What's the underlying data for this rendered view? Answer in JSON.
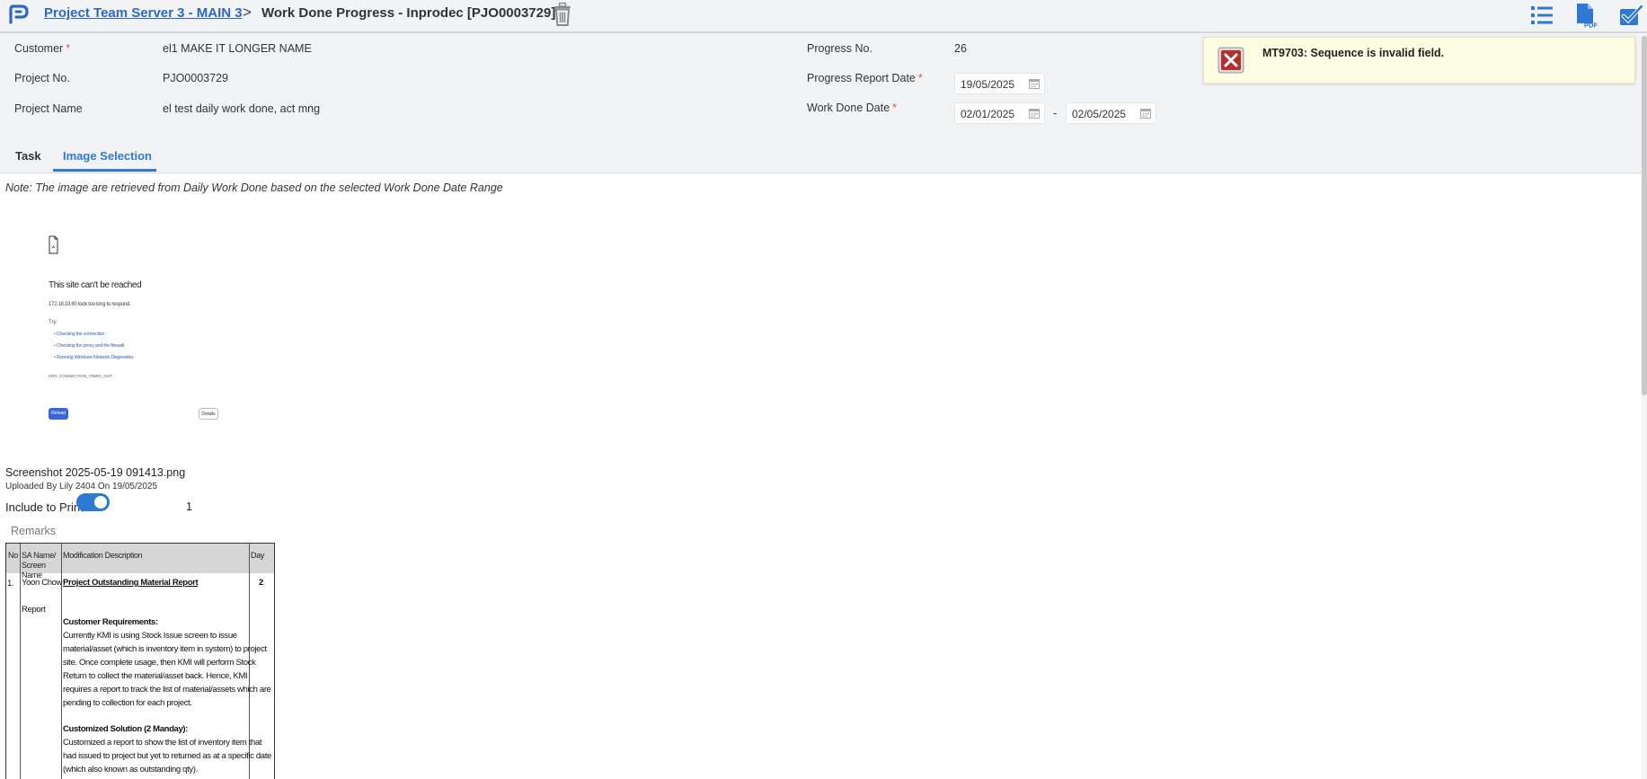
{
  "topbar": {
    "breadcrumb_link": "Project Team Server 3 - MAIN 3",
    "breadcrumb_sep": ">",
    "page_title": "Work Done Progress - Inprodec [PJO0003729]",
    "icons": [
      "logo-icon",
      "trash-icon",
      "list-icon",
      "pdf-icon",
      "checkbox-icon"
    ]
  },
  "header": {
    "customer_label": "Customer",
    "customer_value": "el1 MAKE IT LONGER NAME",
    "project_no_label": "Project No.",
    "project_no_value": "PJO0003729",
    "project_name_label": "Project Name",
    "project_name_value": "el test daily work done, act mng",
    "progress_no_label": "Progress No.",
    "progress_no_value": "26",
    "progress_report_date_label": "Progress Report Date",
    "progress_report_date_value": "19/05/2025",
    "work_done_date_label": "Work Done Date",
    "work_done_from": "02/01/2025",
    "work_done_separator": "-",
    "work_done_to": "02/05/2025",
    "required_mark": "*"
  },
  "tabs": [
    {
      "label": "Task",
      "active": false
    },
    {
      "label": "Image Selection",
      "active": true
    }
  ],
  "toast": {
    "message": "MT9703: Sequence is invalid field.",
    "type": "error"
  },
  "image_selection": {
    "note": "Note: The image are retrieved from Daily Work Done based on the selected Work Done Date Range",
    "thumbnail": {
      "heading": "This site can't be reached",
      "subtext": "172.18.19.60 took too long to respond.",
      "try_label": "Try:",
      "items": [
        "Checking the connection",
        "Checking the proxy and the firewall",
        "Running Windows Network Diagnostics"
      ],
      "error_code": "ERR_CONNECTION_TIMED_OUT",
      "reload_label": "Reload",
      "details_label": "Details"
    },
    "file_name": "Screenshot 2025-05-19 091413.png",
    "uploaded_by": "Uploaded By Lily 2404 On 19/05/2025",
    "include_to_print_label": "Include to Print",
    "include_to_print": true,
    "sequence": "1",
    "remarks_label": "Remarks"
  },
  "remarks_table": {
    "headers": [
      "No",
      "SA Name/ Screen Name",
      "Modification Description",
      "Day"
    ],
    "row": {
      "no": "1.",
      "sa_name": "Yoon Chow",
      "screen_name": "Report",
      "day": "2",
      "title": "Project Outstanding Material Report",
      "req_heading": "Customer Requirements:",
      "req_lines": [
        "Currently KMI is using Stock Issue screen to issue",
        "material/asset (which is inventory item in system) to project",
        "site. Once complete usage, then KMI will perform Stock",
        "Return to collect the material/asset back. Hence, KMI",
        "requires a report to track the list of material/assets which are",
        "pending to collection for each project."
      ],
      "sol_heading": "Customized Solution (2 Manday):",
      "sol_lines": [
        "Customized a report to show the list of inventory item that",
        "had issued to project but yet to returned as at a specific date",
        "(which also known as outstanding qty)."
      ]
    }
  },
  "colors": {
    "accent": "#2e7ad2",
    "link": "#2e67c8",
    "toast_bg": "#fdfde3",
    "error_red": "#b23030",
    "header_bg": "#f2f3f5"
  }
}
